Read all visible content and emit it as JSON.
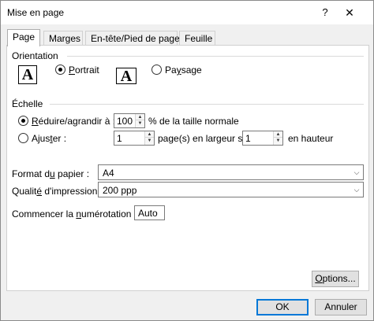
{
  "window": {
    "title": "Mise en page",
    "help_glyph": "?",
    "close_glyph": "✕"
  },
  "tabs": [
    {
      "label": "Page",
      "active": true
    },
    {
      "label": "Marges",
      "active": false
    },
    {
      "label": "En-tête/Pied de page",
      "active": false
    },
    {
      "label": "Feuille",
      "active": false
    }
  ],
  "orientation": {
    "label": "Orientation",
    "portrait_label": "Portrait",
    "landscape_label": "Paysage",
    "icon_glyph": "A",
    "selected": "portrait"
  },
  "scaling": {
    "label": "Échelle",
    "reduce_label": "Réduire/agrandir à :",
    "reduce_value": "100",
    "reduce_suffix": "% de la taille normale",
    "fit_label": "Ajuster :",
    "fit_wide_value": "1",
    "fit_wide_suffix": "page(s) en largeur sur",
    "fit_tall_value": "1",
    "fit_tall_suffix": "en hauteur",
    "selected": "reduce"
  },
  "paper_size": {
    "label": "Format du papier :",
    "value": "A4"
  },
  "print_quality": {
    "label": "Qualité d'impression :",
    "value": "200 ppp"
  },
  "first_page_number": {
    "label": "Commencer la numérotation à :",
    "value": "Auto"
  },
  "buttons": {
    "options": "Options...",
    "ok": "OK",
    "cancel": "Annuler"
  },
  "colors": {
    "default_button_border": "#0078d7",
    "dialog_bg": "#f0f0f0"
  }
}
